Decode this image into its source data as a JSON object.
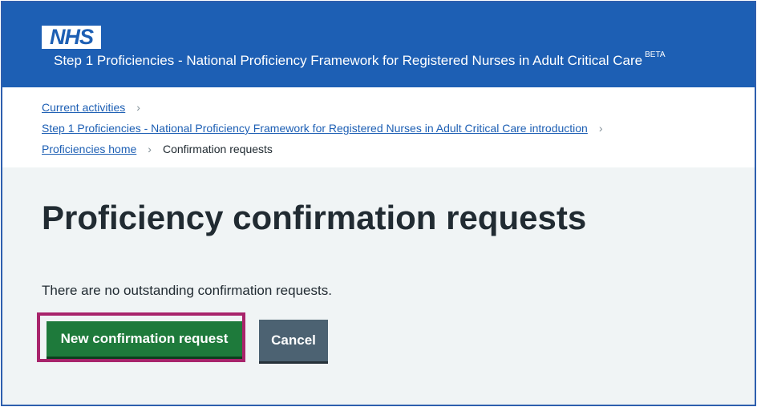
{
  "header": {
    "logo_text": "NHS",
    "service_name": "Step 1 Proficiencies - National Proficiency Framework for Registered Nurses in Adult Critical Care",
    "beta_tag": "BETA",
    "brand_color": "#1d5fb4"
  },
  "breadcrumb": {
    "items": [
      {
        "label": "Current activities"
      },
      {
        "label": "Step 1 Proficiencies - National Proficiency Framework for Registered Nurses in Adult Critical Care introduction"
      },
      {
        "label": "Proficiencies home"
      }
    ],
    "current": "Confirmation requests",
    "separator_icon": "chevron-right-icon"
  },
  "main": {
    "title": "Proficiency confirmation requests",
    "message": "There are no outstanding confirmation requests."
  },
  "actions": {
    "primary_label": "New confirmation request",
    "primary_color": "#1e7a3b",
    "secondary_label": "Cancel",
    "secondary_color": "#4c6272",
    "highlight_color": "#a8246b"
  }
}
